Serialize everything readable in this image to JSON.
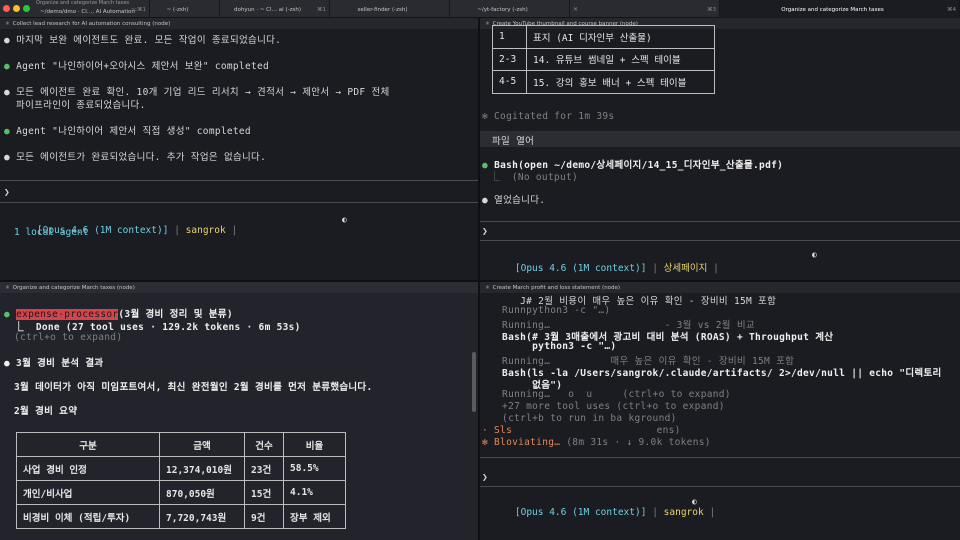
{
  "window": {
    "title": "Organize and categorize March taxes",
    "tabs": [
      {
        "key": "⌥⌘1",
        "title": "~/demo/dmo · Cl…, AI Automation, 소산…"
      },
      {
        "key": "",
        "title": "~ (-zsh)"
      },
      {
        "key": "⌘1",
        "title": "dohyun · ~ Cl… ai (-zsh)"
      },
      {
        "key": "",
        "title": "seller-finder (-zsh)"
      },
      {
        "key": "",
        "title": "~/yt-factory (-zsh)"
      },
      {
        "key": "⌘3",
        "title": ""
      },
      {
        "key": "⌘4",
        "title": "Organize and categorize March taxes"
      }
    ],
    "colors": {
      "close": "#fe5f57",
      "minimize": "#febc2e",
      "zoom": "#28c840"
    }
  },
  "panes": {
    "top_left": {
      "header": "Collect lead research for AI automation consulting (node)",
      "lines": [
        {
          "bullet": "●",
          "text": "마지막 보완 에이전트도 완료. 모든 작업이 종료되었습니다."
        },
        {
          "bullet": "●",
          "text": "Agent \"나인하이어+오아시스 제안서 보완\" completed"
        },
        {
          "bullet": "●",
          "text": "모든 에이전트 완료 확인. 10개 기업 리드 리서치 → 견적서 → 제안서 → PDF 전체"
        },
        {
          "bullet": "",
          "text": "파이프라인이 종료되었습니다."
        },
        {
          "bullet": "●",
          "text": "Agent \"나인하이어 제안서 직접 생성\" completed"
        },
        {
          "bullet": "●",
          "text": "모든 에이전트가 완료되었습니다. 추가 작업은 없습니다."
        }
      ],
      "prompt": "❯",
      "status": {
        "model": "[Opus 4.6 (1M context)]",
        "user": "sangrok",
        "extra": "1 local agent"
      }
    },
    "top_right": {
      "header": "Create YouTube thumbnail and course banner (node)",
      "table": [
        [
          "1",
          "표지 (AI 디자인부 산출물)"
        ],
        [
          "2-3",
          "14. 유튜브 썸네일 + 스펙 테이블"
        ],
        [
          "4-5",
          "15. 강의 홍보 배너 + 스펙 테이블"
        ]
      ],
      "cogitated": "✻ Cogitated for 1m 39s",
      "user_msg": "파일 열어",
      "bash": "Bash(open ~/demo/상세페이지/14_15_디자인부_산출물.pdf)",
      "bash_out": "⎿  (No output)",
      "done": "열었습니다.",
      "prompt": "❯",
      "status": {
        "model": "[Opus 4.6 (1M context)]",
        "user": "상세페이지"
      }
    },
    "bottom_left": {
      "header": "Organize and categorize March taxes (node)",
      "agent_name": "expense-processor",
      "agent_task": "(3월 경비 정리 및 분류)",
      "agent_done": "⎿  Done (27 tool uses · 129.2k tokens · 6m 53s)",
      "expand": "(ctrl+o to expand)",
      "heading": "3월 경비 분석 결과",
      "summary": "3월 데이터가 아직 미임포트여서, 최신 완전월인 2월 경비를 먼저 분류했습니다.",
      "subheading": "2월 경비 요약",
      "table_header": [
        "구분",
        "금액",
        "건수",
        "비율"
      ],
      "table_rows": [
        [
          "사업 경비 인정",
          "12,374,010원",
          "23건",
          "58.5%"
        ],
        [
          "개인/비사업",
          "870,050원",
          "15건",
          "4.1%"
        ],
        [
          "비경비 이체 (적립/투자)",
          "7,720,743원",
          "9건",
          "장부 제외"
        ]
      ]
    },
    "bottom_right": {
      "header": "Create March profit and loss statement (node)",
      "lines": [
        {
          "cls": "",
          "text": "      J# 2월 비용이 매우 높은 이유 확인 - 장비비 15M 포함"
        },
        {
          "cls": "dim",
          "text": "   Runnpython3 -c \"…)"
        },
        {
          "cls": "dim",
          "text": "   Running…                   - 3월 vs 2월 비교"
        },
        {
          "cls": "",
          "text": "   Bash(# 3월 3매출에서 광고비 대비 분석 (ROAS) + Throughput 계산"
        },
        {
          "cls": "",
          "text": "        python3 -c \"…)"
        },
        {
          "cls": "dim",
          "text": "   Running…          매우 높은 이유 확인 - 장비비 15M 포함"
        },
        {
          "cls": "",
          "text": "   Bash(ls -la /Users/sangrok/.claude/artifacts/ 2>/dev/null || echo \"디렉토리"
        },
        {
          "cls": "",
          "text": "        없음\")"
        },
        {
          "cls": "dim",
          "text": "   Running…   o  u     (ctrl+o to expand)"
        },
        {
          "cls": "dim",
          "text": "   +27 more tool uses (ctrl+o to expand)"
        },
        {
          "cls": "dim",
          "text": "   (ctrl+b to run in ba kground)"
        }
      ],
      "spinner1": "· Sls",
      "spinner1_tail": "ens)",
      "spinner2": "✻ Bloviating…",
      "spinner2_tail": " (8m 31s · ↓ 9.0k tokens)",
      "prompt": "❯",
      "status": {
        "model": "[Opus 4.6 (1M context)]",
        "user": "sangrok"
      }
    }
  }
}
